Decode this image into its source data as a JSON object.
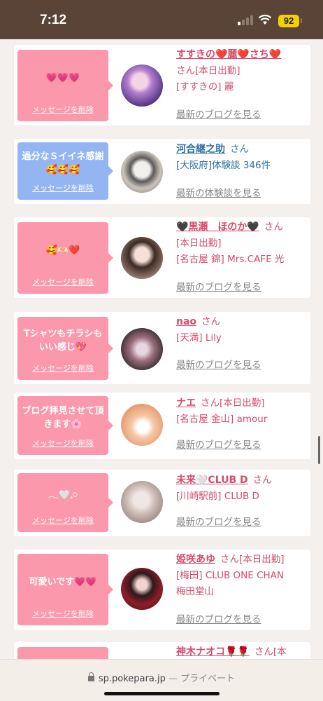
{
  "status_bar": {
    "time": "7:12",
    "battery": "92",
    "icons": [
      "signal-icon",
      "wifi-icon",
      "battery-icon"
    ]
  },
  "delete_label": "メッセージを削除",
  "posts": [
    {
      "message": "💗💗💗",
      "bubble_color": "#fb98ab",
      "name": "すすきの❤️麗❤️さち❤️",
      "line1": "さん[本日出勤]",
      "line2": "[すすきの] 麗",
      "link": "最新のブログを見る"
    },
    {
      "message": "過分なＳイイネ感謝🥰🥰🥰",
      "bubble_color": "#93b6f2",
      "name": "河合継之助",
      "san": "さん",
      "line1": "[大阪府]体験談 346件",
      "link": "最新の体験談を見る"
    },
    {
      "message": "🥰🫶🏻❤️",
      "bubble_color": "#fb98ab",
      "name": "🖤黒瀬　ほのか🖤",
      "san": "さん",
      "line1": "[本日出勤]",
      "line2": "[名古屋 錦] Mrs.CAFE 光",
      "link": "最新のブログを見る"
    },
    {
      "message": "Tシャツもチラシもいい感じ💖",
      "bubble_color": "#fb98ab",
      "name": "nao",
      "san": "さん",
      "line1": "[天満] Lily",
      "link": "最新のブログを見る"
    },
    {
      "message": "ブログ拝見させて頂きます🌸",
      "bubble_color": "#fb98ab",
      "name": "ナエ",
      "san": "さん[本日出勤]",
      "line1": "[名古屋 金山] amour",
      "link": "最新のブログを見る"
    },
    {
      "message": "𓂃🤍𓈒𓏸",
      "bubble_color": "#fb98ab",
      "name": "未来🤍CLUB D",
      "san": "さん",
      "line1": "[川崎駅前] CLUB D",
      "link": "最新のブログを見る"
    },
    {
      "message": "可愛いです💗💗",
      "bubble_color": "#fb98ab",
      "name": "姫咲あゆ",
      "san": "さん[本日出勤]",
      "line1": "[梅田] CLUB ONE CHAN",
      "line2": "梅田堂山",
      "link": "最新のブログを見る"
    },
    {
      "message": "",
      "bubble_color": "#fb98ab",
      "name": "神木ナオコ🌹🌹",
      "san": "さん[本",
      "link": ""
    }
  ],
  "url_bar": {
    "domain": "sp.pokepara.jp",
    "separator": " — ",
    "privacy": "プライベート"
  }
}
